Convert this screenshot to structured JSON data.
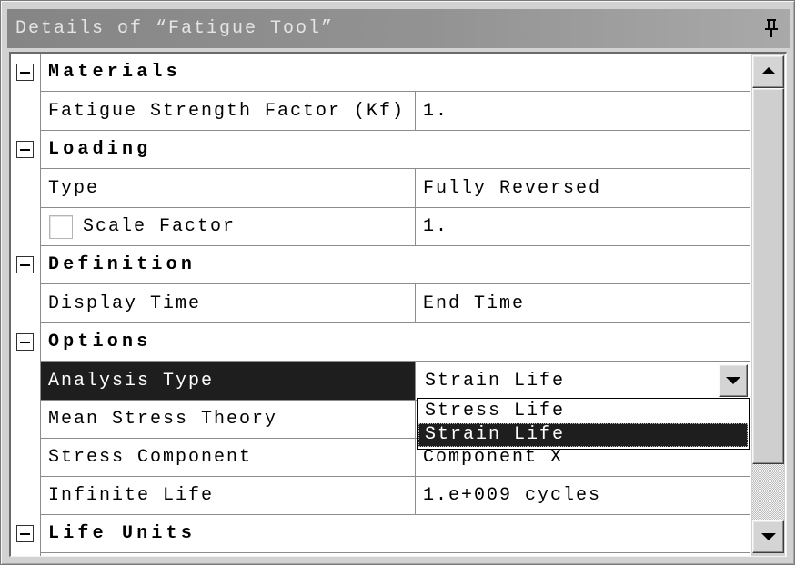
{
  "window": {
    "title": "Details of “Fatigue Tool”",
    "pin_icon": "pin-icon"
  },
  "groups": [
    {
      "label": "Materials",
      "collapse_icon": "minus-icon",
      "rows": [
        {
          "name": "Fatigue Strength Factor (Kf)",
          "value": "1."
        }
      ]
    },
    {
      "label": "Loading",
      "collapse_icon": "minus-icon",
      "rows": [
        {
          "name": "Type",
          "value": "Fully Reversed"
        },
        {
          "name": "Scale Factor",
          "value": "1.",
          "checked": false
        }
      ]
    },
    {
      "label": "Definition",
      "collapse_icon": "minus-icon",
      "rows": [
        {
          "name": "Display Time",
          "value": "End Time"
        }
      ]
    },
    {
      "label": "Options",
      "collapse_icon": "minus-icon",
      "rows": [
        {
          "name": "Analysis Type",
          "value": "Strain Life",
          "selected": true
        },
        {
          "name": "Mean Stress Theory"
        },
        {
          "name": "Stress Component",
          "value": "Component X"
        },
        {
          "name": "Infinite Life",
          "value": "1.e+009 cycles"
        }
      ]
    },
    {
      "label": "Life Units",
      "collapse_icon": "minus-icon",
      "rows": []
    }
  ],
  "analysis_type_dropdown": {
    "open": true,
    "options": [
      "Stress Life",
      "Strain Life"
    ],
    "highlighted_index": 1,
    "arrow_icon": "chevron-down-icon"
  },
  "scrollbar": {
    "up_icon": "up-arrow-icon",
    "down_icon": "down-arrow-icon",
    "scroll_position": 0,
    "visible_fraction": 0.87
  },
  "colors": {
    "selection_background": "#1e1e1e",
    "selection_text": "#ffffff",
    "grid_line": "#8c8c8c"
  }
}
